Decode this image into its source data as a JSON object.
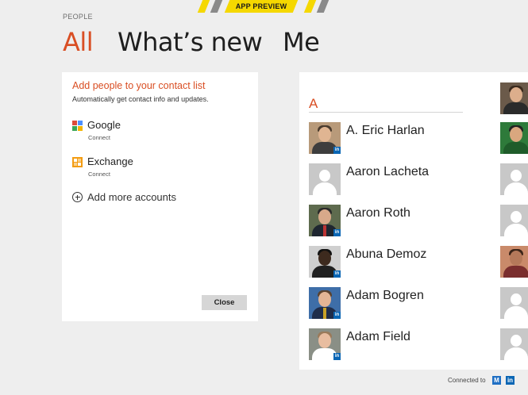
{
  "banner": {
    "label": "APP PREVIEW",
    "stripe_colors": [
      "#f5d800",
      "#8a8a8a"
    ]
  },
  "header": {
    "section": "PEOPLE",
    "pivots": [
      {
        "label": "All",
        "active": true
      },
      {
        "label": "What’s new",
        "active": false
      },
      {
        "label": "Me",
        "active": false
      }
    ]
  },
  "accounts_card": {
    "title": "Add people to your contact list",
    "subtitle": "Automatically get contact info and updates.",
    "accounts": [
      {
        "name": "Google",
        "status": "Connect",
        "icon": "google-icon"
      },
      {
        "name": "Exchange",
        "status": "Connect",
        "icon": "exchange-icon"
      }
    ],
    "add_more": "Add more accounts",
    "close_label": "Close"
  },
  "contacts": {
    "group_letter": "A",
    "list": [
      {
        "name": "A. Eric Harlan",
        "has_photo": true,
        "linkedin": true
      },
      {
        "name": "Aaron Lacheta",
        "has_photo": false,
        "linkedin": false
      },
      {
        "name": "Aaron Roth",
        "has_photo": true,
        "linkedin": true
      },
      {
        "name": "Abuna Demoz",
        "has_photo": true,
        "linkedin": true
      },
      {
        "name": "Adam Bogren",
        "has_photo": true,
        "linkedin": true
      },
      {
        "name": "Adam Field",
        "has_photo": true,
        "linkedin": true
      }
    ]
  },
  "footer": {
    "connected_to": "Connected to",
    "services": [
      "messenger-icon",
      "linkedin-icon"
    ]
  },
  "colors": {
    "accent": "#d94e23",
    "linkedin": "#0a66b4",
    "messenger": "#1f6fc4"
  }
}
